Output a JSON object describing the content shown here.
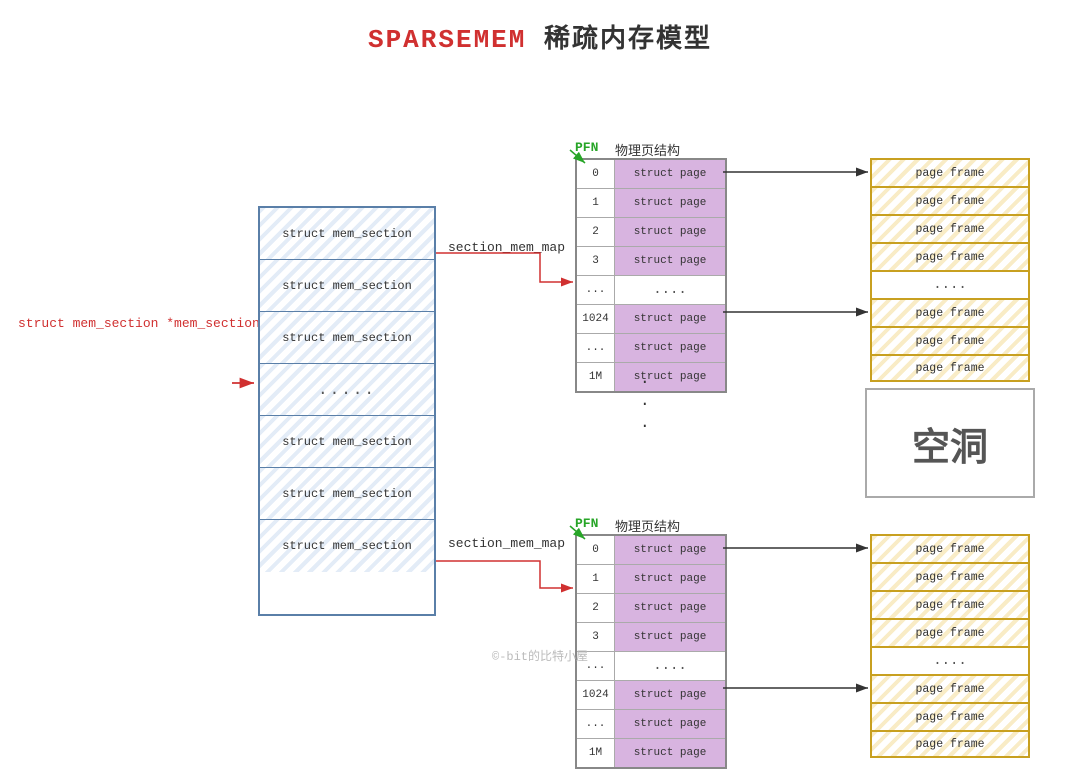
{
  "title": {
    "part1": "SPARSEMEM",
    "part2": " 稀疏内存模型"
  },
  "pointer_label": "struct mem_section *mem_section",
  "mem_section_rows": [
    {
      "text": "struct mem_section",
      "type": "normal"
    },
    {
      "text": "struct mem_section",
      "type": "normal"
    },
    {
      "text": "struct mem_section",
      "type": "normal"
    },
    {
      "text": ".....",
      "type": "dots"
    },
    {
      "text": "struct mem_section",
      "type": "normal"
    },
    {
      "text": "struct mem_section",
      "type": "normal"
    },
    {
      "text": "struct mem_section",
      "type": "normal"
    }
  ],
  "section_mem_map_top": "section_mem_map",
  "section_mem_map_bot": "section_mem_map",
  "pfn_label": "PFN",
  "pfn_desc": "物理页结构",
  "pfn_rows_top": [
    {
      "index": "0",
      "cell": "struct page"
    },
    {
      "index": "1",
      "cell": "struct page"
    },
    {
      "index": "2",
      "cell": "struct page"
    },
    {
      "index": "3",
      "cell": "struct page"
    },
    {
      "index": "...",
      "cell": "...."
    },
    {
      "index": "1024",
      "cell": "struct page"
    },
    {
      "index": "...",
      "cell": "struct page"
    },
    {
      "index": "1M",
      "cell": "struct page"
    }
  ],
  "pfn_rows_bot": [
    {
      "index": "0",
      "cell": "struct page"
    },
    {
      "index": "1",
      "cell": "struct page"
    },
    {
      "index": "2",
      "cell": "struct page"
    },
    {
      "index": "3",
      "cell": "struct page"
    },
    {
      "index": "...",
      "cell": "...."
    },
    {
      "index": "1024",
      "cell": "struct page"
    },
    {
      "index": "...",
      "cell": "struct page"
    },
    {
      "index": "1M",
      "cell": "struct page"
    }
  ],
  "page_frames_top": [
    {
      "text": "page frame",
      "type": "normal"
    },
    {
      "text": "page frame",
      "type": "normal"
    },
    {
      "text": "page frame",
      "type": "normal"
    },
    {
      "text": "page frame",
      "type": "normal"
    },
    {
      "text": "....",
      "type": "dots"
    },
    {
      "text": "page frame",
      "type": "normal"
    },
    {
      "text": "page frame",
      "type": "normal"
    },
    {
      "text": "page frame",
      "type": "normal"
    }
  ],
  "page_frames_bot": [
    {
      "text": "page frame",
      "type": "normal"
    },
    {
      "text": "page frame",
      "type": "normal"
    },
    {
      "text": "page frame",
      "type": "normal"
    },
    {
      "text": "page frame",
      "type": "normal"
    },
    {
      "text": "....",
      "type": "dots"
    },
    {
      "text": "page frame",
      "type": "normal"
    },
    {
      "text": "page frame",
      "type": "normal"
    },
    {
      "text": "page frame",
      "type": "normal"
    }
  ],
  "hollow_label": "空洞",
  "middle_dots": [
    "·",
    "·",
    "·"
  ],
  "watermark": "©-bit的比特小屋"
}
